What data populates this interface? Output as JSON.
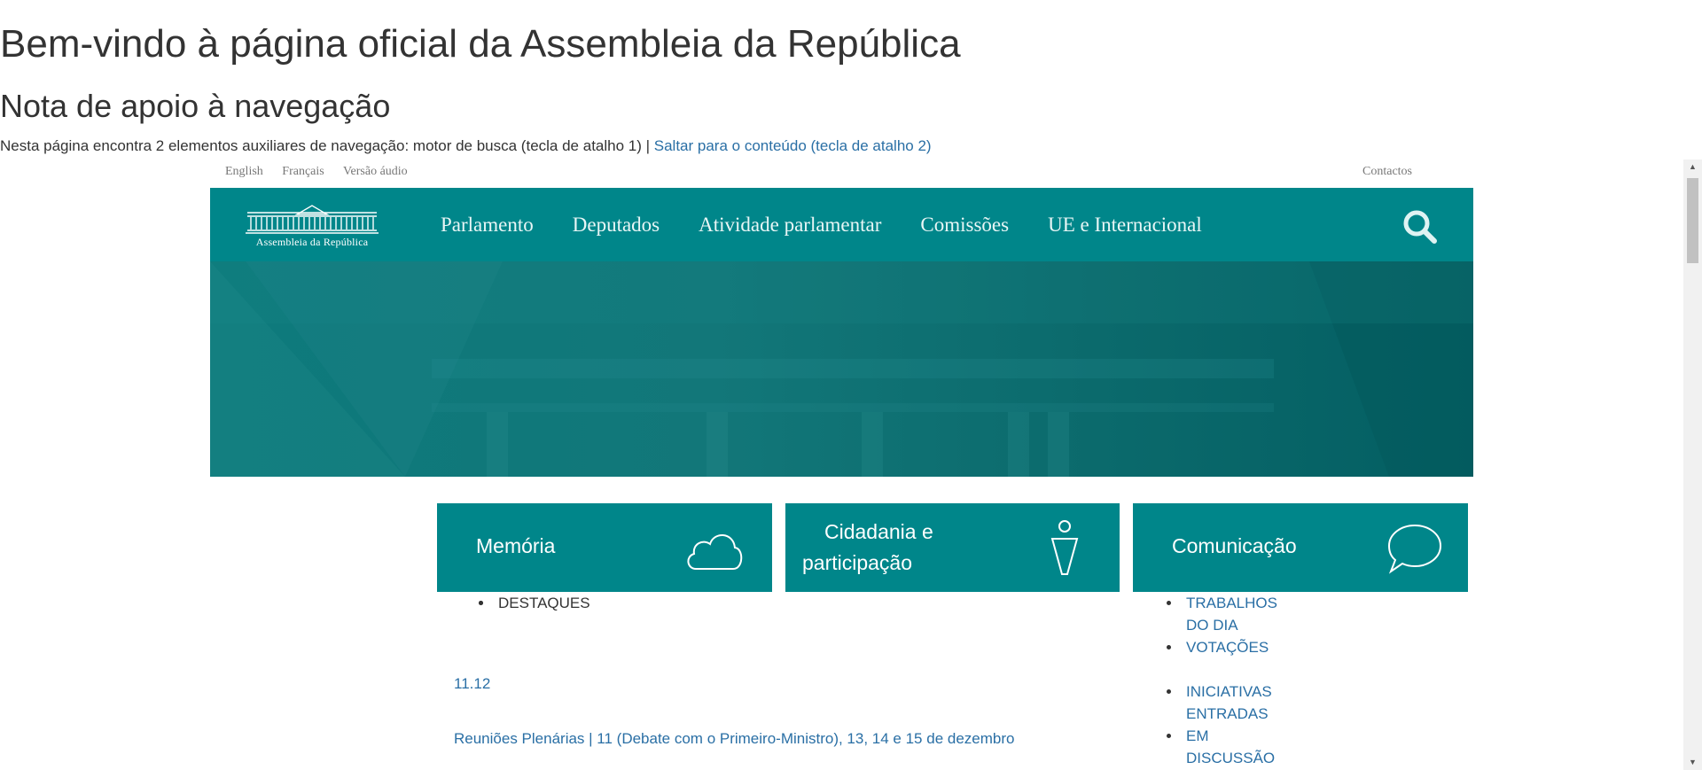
{
  "page": {
    "title": "Bem-vindo à página oficial da Assembleia da República",
    "subtitle": "Nota de apoio à navegação",
    "nav_note_text": "Nesta página encontra 2 elementos auxiliares de navegação: motor de busca (tecla de atalho 1) | ",
    "skip_link": "Saltar para o conteúdo (tecla de atalho 2)"
  },
  "utility": {
    "languages": [
      "English",
      "Français",
      "Versão áudio"
    ],
    "contacts": "Contactos"
  },
  "header": {
    "logo_text": "Assembleia da República",
    "menu": [
      "Parlamento",
      "Deputados",
      "Atividade parlamentar",
      "Comissões",
      "UE e Internacional"
    ],
    "search_icon": "search-icon"
  },
  "tiles": [
    {
      "label_line1": "Memória",
      "label_line2": "",
      "icon": "cloud-icon"
    },
    {
      "label_line1": "Cidadania e",
      "label_line2": "participação",
      "icon": "person-icon"
    },
    {
      "label_line1": "Comunicação",
      "label_line2": "",
      "icon": "speech-bubble-icon"
    }
  ],
  "memoria": {
    "list": [
      "",
      "DESTAQUES"
    ],
    "date": "11.12",
    "news_title": "Reuniões Plenárias | 11 (Debate com o Primeiro-Ministro), 13, 14 e 15 de dezembro"
  },
  "comunicacao": {
    "group1": [
      "TRABALHOS DO DIA",
      "VOTAÇÕES"
    ],
    "group2": [
      "INICIATIVAS ENTRADAS",
      "EM DISCUSSÃO"
    ]
  },
  "colors": {
    "teal": "#00868a",
    "link": "#2a6fa5"
  }
}
